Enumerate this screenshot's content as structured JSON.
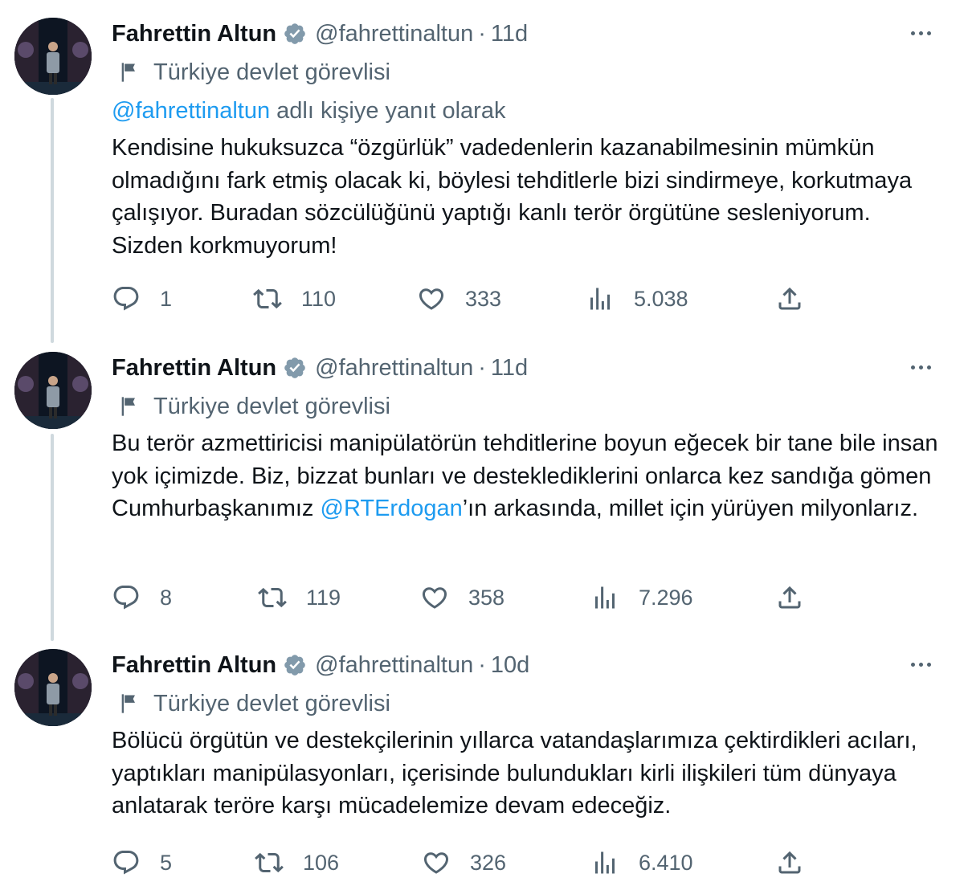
{
  "tweets": [
    {
      "author": "Fahrettin Altun",
      "handle": "@fahrettinaltun",
      "separator": "·",
      "time": "11d",
      "label": "Türkiye devlet görevlisi",
      "reply_to_handle": "@fahrettinaltun",
      "reply_to_suffix": " adlı kişiye yanıt olarak",
      "text_parts": [
        "Kendisine hukuksuzca “özgürlük” vadedenlerin kazanabilmesinin mümkün olmadığını fark etmiş olacak ki, böylesi tehditlerle bizi sindirmeye, korkutmaya çalışıyor. Buradan sözcülüğünü yaptığı kanlı terör örgütüne sesleniyorum. Sizden korkmuyorum!"
      ],
      "replies": "1",
      "retweets": "110",
      "likes": "333",
      "views": "5.038"
    },
    {
      "author": "Fahrettin Altun",
      "handle": "@fahrettinaltun",
      "separator": "·",
      "time": "11d",
      "label": "Türkiye devlet görevlisi",
      "text_parts": [
        "Bu terör azmettiricisi manipülatörün tehditlerine boyun eğecek bir tane bile insan yok içimizde. Biz, bizzat bunları ve destekledikleri­ni onlarca kez sandığa gömen Cumhurbaşkanımız ",
        "@RTErdogan",
        "’ın arkasında, millet için yürüyen milyonlarız."
      ],
      "replies": "8",
      "retweets": "119",
      "likes": "358",
      "views": "7.296"
    },
    {
      "author": "Fahrettin Altun",
      "handle": "@fahrettinaltun",
      "separator": "·",
      "time": "10d",
      "label": "Türkiye devlet görevlisi",
      "text_parts": [
        "Bölücü örgütün ve destekçilerinin yıllarca vatandaşlarımıza çektirdikleri acıları, yaptıkları manipülasyonları, içerisinde bulundukları kirli ilişkileri tüm dünyaya anlatarak teröre karşı mücadelemize devam edeceğiz."
      ],
      "replies": "5",
      "retweets": "106",
      "likes": "326",
      "views": "6.410"
    }
  ],
  "icons": {
    "reply": "speech-bubble-icon",
    "retweet": "retweet-arrows-icon",
    "like": "heart-icon",
    "views": "bar-chart-icon",
    "share": "upload-icon",
    "verified": "verified-badge-icon",
    "label": "flag-icon",
    "more": "more-dots-icon"
  },
  "colors": {
    "link": "#1d9bf0",
    "secondary_text": "#536471",
    "verified_badge": "#829aab",
    "thread_line": "#cfd9de"
  }
}
